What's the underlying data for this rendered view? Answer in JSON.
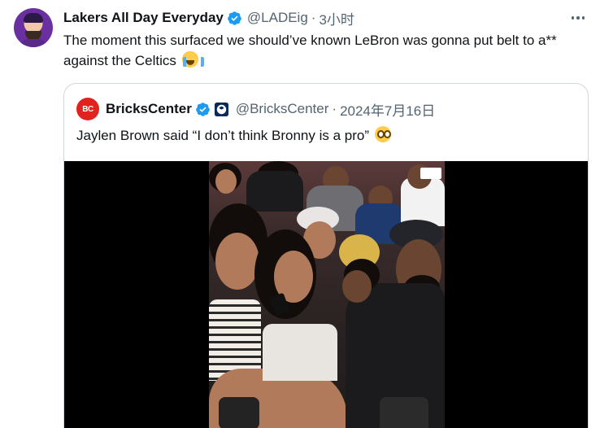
{
  "tweet": {
    "display_name": "Lakers All Day Everyday",
    "handle": "@LADEig",
    "separator": "·",
    "time": "3小时",
    "text": "The moment this surfaced we should’ve known LeBron was gonna put belt to a** against the Celtics",
    "emoji": "loudly-crying-face",
    "verified_color": "#1d9bf0"
  },
  "quote": {
    "display_name": "BricksCenter",
    "avatar_text": "BC",
    "handle": "@BricksCenter",
    "separator": "·",
    "date": "2024年7月16日",
    "text": "Jaylen Brown said “I don’t think Bronny is a pro”",
    "emoji": "flushed-face",
    "verified_color": "#1d9bf0",
    "brand_color": "#e0231f"
  },
  "icons": {
    "more": "more-horizontal-icon",
    "verified": "verified-badge-icon",
    "affiliate": "affiliate-badge-icon"
  }
}
